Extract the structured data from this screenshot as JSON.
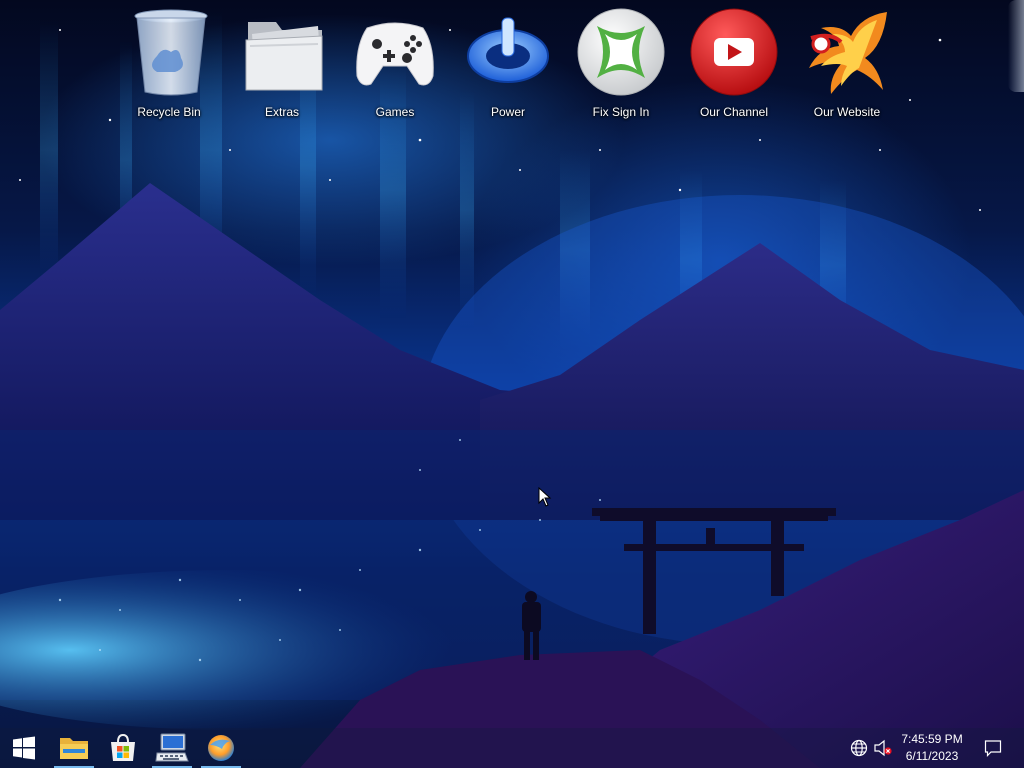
{
  "desktop": {
    "icons": [
      {
        "label": "Recycle Bin",
        "icon": "recycle-bin-icon"
      },
      {
        "label": "Extras",
        "icon": "folder-icon"
      },
      {
        "label": "Games",
        "icon": "gamepad-icon"
      },
      {
        "label": "Power",
        "icon": "power-icon"
      },
      {
        "label": "Fix Sign In",
        "icon": "xbox-icon"
      },
      {
        "label": "Our Channel",
        "icon": "youtube-icon"
      },
      {
        "label": "Our Website",
        "icon": "phoenix-logo-icon"
      }
    ]
  },
  "taskbar": {
    "start": {
      "icon": "windows-logo-icon"
    },
    "pinned": [
      {
        "icon": "file-explorer-icon",
        "running": true
      },
      {
        "icon": "store-icon",
        "running": false
      },
      {
        "icon": "computer-keyboard-icon",
        "running": true
      },
      {
        "icon": "browser-icon",
        "running": true
      }
    ],
    "tray": {
      "network_icon": "globe-icon",
      "volume_icon": "volume-muted-icon",
      "notifications_icon": "action-center-icon"
    },
    "clock": {
      "time": "7:45:59 PM",
      "date": "6/11/2023"
    }
  },
  "colors": {
    "accent": "#76b9ed",
    "sky_top": "#03081f",
    "sky_glow": "#0a3a9c",
    "mountain": "#16166a",
    "ground": "#2a1460"
  }
}
